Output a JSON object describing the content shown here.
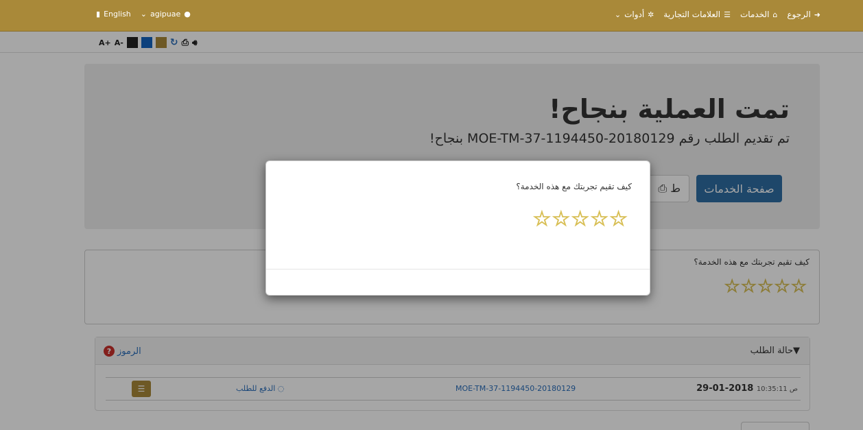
{
  "navbar": {
    "language": "English",
    "username": "agipuae",
    "back": "الرجوع",
    "services": "الخدمات",
    "trademarks": "العلامات التجارية",
    "tools": "أدوات"
  },
  "accessibility": {
    "font_increase": "A+",
    "font_decrease": "A-",
    "swatches": [
      "#222222",
      "#1565c0",
      "#a98939"
    ]
  },
  "jumbotron": {
    "title": "تمت العملية بنجاح!",
    "subtitle": "تم تقديم الطلب رقم MOE-TM-37-1194450-20180129 بنجاح!",
    "services_button": "صفحة الخدمات",
    "print_button": "ط"
  },
  "rating_panel": {
    "question": "كيف تقيم تجربتك مع هذه الخدمة؟",
    "stars": 5,
    "selected": 0
  },
  "status_panel": {
    "title": "حالة الطلب",
    "legend_link": "الرموز",
    "row": {
      "date": "29-01-2018",
      "time": "10:35:11 ص",
      "reference": "MOE-TM-37-1194450-20180129",
      "action": "الدفع للطلب"
    }
  },
  "modal": {
    "question": "كيف تقيم تجربتك مع هذه الخدمة؟",
    "stars": 5,
    "selected": 0
  }
}
